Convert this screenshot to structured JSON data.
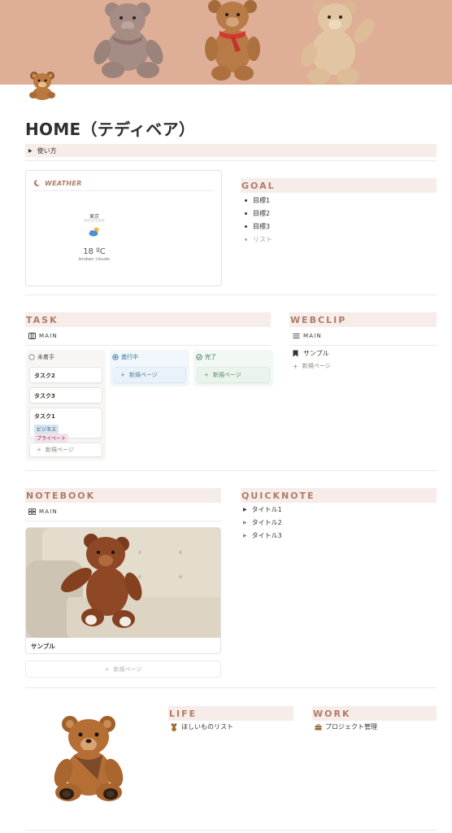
{
  "page": {
    "title": "HOME（テディベア）",
    "toggle_label": "使い方"
  },
  "weather": {
    "header": "WEATHER",
    "city": "東京",
    "sublabel": "WEATHER",
    "temperature": "18 ºC",
    "description": "broken clouds"
  },
  "goal": {
    "heading": "GOAL",
    "items": [
      "目標1",
      "目標2",
      "目標3"
    ],
    "placeholder": "リスト"
  },
  "task": {
    "heading": "TASK",
    "view_label": "MAIN",
    "columns": [
      {
        "label": "未着手",
        "color": "#37352f"
      },
      {
        "label": "進行中",
        "color": "#2f6f97"
      },
      {
        "label": "完了",
        "color": "#3c7a4a"
      }
    ],
    "cards": [
      {
        "title": "タスク2"
      },
      {
        "title": "タスク3"
      },
      {
        "title": "タスク1",
        "tags": [
          "ビジネス",
          "プライベート"
        ]
      }
    ],
    "new_page": "新規ページ"
  },
  "webclip": {
    "heading": "WEBCLIP",
    "view_label": "MAIN",
    "item": "サンプル",
    "new_page": "新規ページ"
  },
  "notebook": {
    "heading": "NOTEBOOK",
    "view_label": "MAIN",
    "card_title": "サンプル",
    "new_page": "新規ページ"
  },
  "quicknote": {
    "heading": "QUICKNOTE",
    "items": [
      "タイトル1",
      "タイトル2",
      "タイトル3"
    ]
  },
  "life": {
    "heading": "LIFE",
    "link": "ほしいものリスト"
  },
  "work": {
    "heading": "WORK",
    "link": "プロジェクト管理"
  },
  "colors": {
    "accent": "#b07b66",
    "cover": "#dfae97",
    "section_bg": "#f6ecea",
    "tag_business": "#d3e5ef",
    "tag_private": "#f5e0e9"
  }
}
